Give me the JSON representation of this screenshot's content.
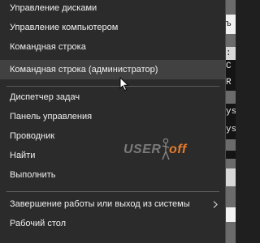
{
  "background_window": {
    "lines": [
      "ъ",
      "ь",
      ":",
      "C",
      "R",
      "ys",
      "y",
      "ys",
      "\\"
    ]
  },
  "menu": {
    "items": [
      {
        "label": "Управление дисками"
      },
      {
        "label": "Управление компьютером"
      },
      {
        "label": "Командная строка"
      },
      {
        "label": "Командная строка (администратор)"
      },
      {
        "label": "Диспетчер задач"
      },
      {
        "label": "Панель управления"
      },
      {
        "label": "Проводник"
      },
      {
        "label": "Найти"
      },
      {
        "label": "Выполнить"
      },
      {
        "label": "Завершение работы или выход из системы"
      },
      {
        "label": "Рабочий стол"
      }
    ],
    "hovered_item": "Командная строка (администратор)",
    "submenu_icon": "chevron-right-icon"
  },
  "watermark": {
    "user_text": "USER",
    "off_text": "off",
    "icon": "person-figure-icon"
  },
  "colors": {
    "menu_bg": "#2b2b2b",
    "hover_bg": "#414141",
    "text": "#f0f0f0",
    "separator": "#5a5a5a",
    "watermark_accent": "#e37b2b"
  }
}
